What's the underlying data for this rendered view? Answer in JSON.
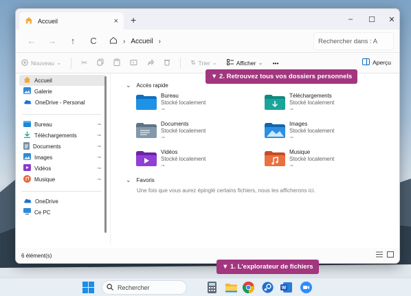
{
  "window": {
    "tab_title": "Accueil",
    "tab_close": "×",
    "new_tab": "+",
    "minimize": "–",
    "maximize": "☐",
    "close": "✕"
  },
  "navbar": {
    "back": "←",
    "forward": "→",
    "up": "↑",
    "refresh": "C",
    "breadcrumb_current": "Accueil",
    "breadcrumb_sep": "›",
    "breadcrumb_trailing": "›",
    "search_placeholder": "Rechercher dans : A"
  },
  "toolbar": {
    "new_label": "Nouveau",
    "sort_label": "Trier",
    "view_label": "Afficher",
    "more_label": "•••",
    "preview_label": "Aperçu"
  },
  "sidebar": {
    "top_items": [
      {
        "label": "Accueil",
        "icon": "home-icon"
      },
      {
        "label": "Galerie",
        "icon": "gallery-icon"
      },
      {
        "label": "OneDrive - Personal",
        "icon": "cloud-icon"
      }
    ],
    "pinned_items": [
      {
        "label": "Bureau",
        "icon": "desktop-icon"
      },
      {
        "label": "Téléchargements",
        "icon": "download-icon"
      },
      {
        "label": "Documents",
        "icon": "document-icon"
      },
      {
        "label": "Images",
        "icon": "images-icon"
      },
      {
        "label": "Vidéos",
        "icon": "video-icon"
      },
      {
        "label": "Musique",
        "icon": "music-icon"
      }
    ],
    "bottom_items": [
      {
        "label": "OneDrive",
        "icon": "cloud-icon"
      },
      {
        "label": "Ce PC",
        "icon": "pc-icon"
      }
    ],
    "pin_glyph": "📌"
  },
  "main": {
    "quick_access_header": "Accès rapide",
    "quick_access": [
      {
        "name": "Bureau",
        "sub": "Stocké localement",
        "icon": "desktop-folder-icon"
      },
      {
        "name": "Téléchargements",
        "sub": "Stocké localement",
        "icon": "downloads-folder-icon"
      },
      {
        "name": "Documents",
        "sub": "Stocké localement",
        "icon": "documents-folder-icon"
      },
      {
        "name": "Images",
        "sub": "Stocké localement",
        "icon": "images-folder-icon"
      },
      {
        "name": "Vidéos",
        "sub": "Stocké localement",
        "icon": "videos-folder-icon"
      },
      {
        "name": "Musique",
        "sub": "Stocké localement",
        "icon": "music-folder-icon"
      }
    ],
    "pin_glyph": "⊸",
    "favorites_header": "Favoris",
    "favorites_empty": "Une fois que vous aurez épinglé certains fichiers, nous les afficherons ici."
  },
  "statusbar": {
    "count": "6 élément(s)"
  },
  "callouts": {
    "top": "▼ 2. Retrouvez tous vos dossiers personnels",
    "bottom": "▼ 1. L'explorateur de fichiers"
  },
  "taskbar": {
    "search_label": "Rechercher"
  },
  "colors": {
    "callout": "#a2367f",
    "accent": "#0067c0",
    "folder_blue": "#1e88d6",
    "folder_teal": "#1aa59a"
  }
}
